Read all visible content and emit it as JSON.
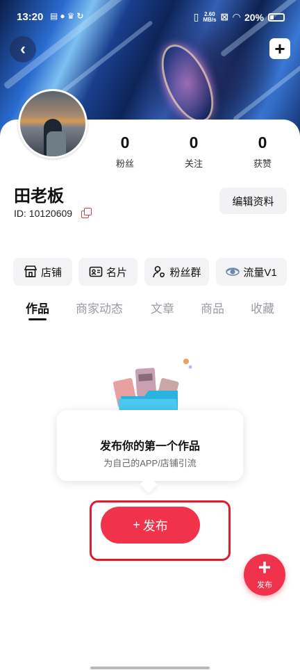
{
  "status_bar": {
    "time": "13:20",
    "net_speed": "2.60",
    "net_unit": "MB/s",
    "battery": "20%"
  },
  "profile": {
    "name": "田老板",
    "id_text": "ID: 10120609",
    "edit_label": "编辑资料",
    "stats": [
      {
        "value": "0",
        "label": "粉丝"
      },
      {
        "value": "0",
        "label": "关注"
      },
      {
        "value": "0",
        "label": "获赞"
      }
    ]
  },
  "chips": [
    {
      "label": "店铺",
      "icon": "store-icon"
    },
    {
      "label": "名片",
      "icon": "id-card-icon"
    },
    {
      "label": "粉丝群",
      "icon": "fan-group-icon"
    },
    {
      "label": "流量V1",
      "icon": "traffic-badge-icon"
    }
  ],
  "tabs": [
    "作品",
    "商家动态",
    "文章",
    "商品",
    "收藏"
  ],
  "active_tab": "作品",
  "empty_state": {
    "title": "发布你的第一个作品",
    "subtitle": "为自己的APP/店铺引流",
    "button_label": "发布"
  },
  "fab": {
    "label": "发布"
  },
  "colors": {
    "accent": "#f0334b",
    "highlight_border": "#e21a2b"
  }
}
